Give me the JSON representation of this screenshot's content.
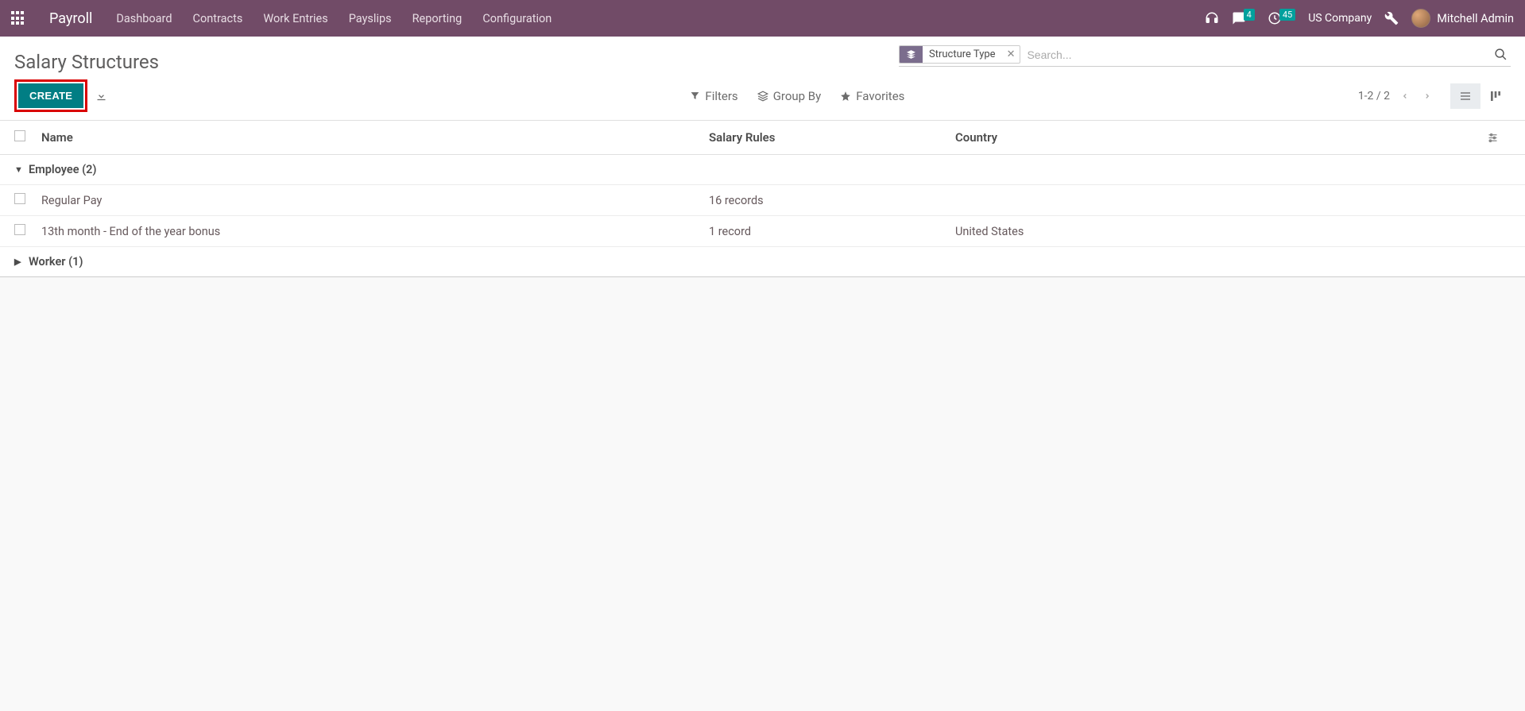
{
  "navbar": {
    "brand": "Payroll",
    "links": [
      "Dashboard",
      "Contracts",
      "Work Entries",
      "Payslips",
      "Reporting",
      "Configuration"
    ],
    "badge_messages": "4",
    "badge_activities": "45",
    "company": "US Company",
    "user": "Mitchell Admin"
  },
  "controlPanel": {
    "title": "Salary Structures",
    "createLabel": "CREATE",
    "search": {
      "facetLabel": "Structure Type",
      "placeholder": "Search..."
    },
    "filtersLabel": "Filters",
    "groupByLabel": "Group By",
    "favoritesLabel": "Favorites",
    "pager": "1-2 / 2"
  },
  "table": {
    "headers": {
      "name": "Name",
      "rules": "Salary Rules",
      "country": "Country"
    },
    "groups": [
      {
        "label": "Employee (2)",
        "expanded": true,
        "rows": [
          {
            "name": "Regular Pay",
            "rules": "16 records",
            "country": ""
          },
          {
            "name": "13th month - End of the year bonus",
            "rules": "1 record",
            "country": "United States"
          }
        ]
      },
      {
        "label": "Worker (1)",
        "expanded": false,
        "rows": []
      }
    ]
  }
}
